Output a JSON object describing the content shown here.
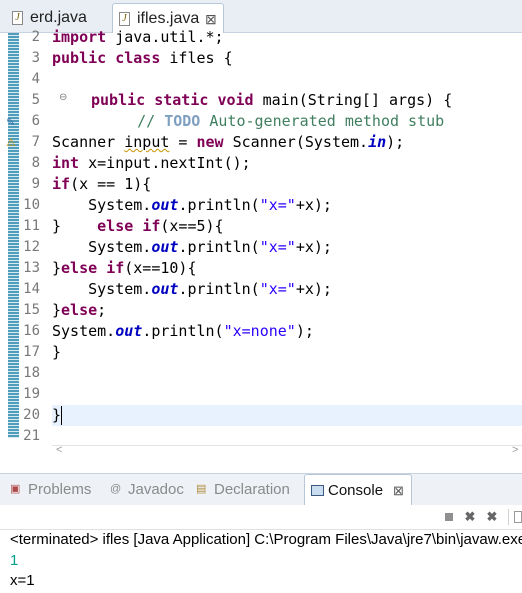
{
  "editor_tabs": [
    {
      "label": "erd.java",
      "icon": "java-file-icon"
    },
    {
      "label": "ifles.java",
      "icon": "java-file-icon",
      "close": "⊠"
    }
  ],
  "editor": {
    "line_numbers": [
      "2",
      "3",
      "4",
      "5",
      "6",
      "7",
      "8",
      "9",
      "10",
      "11",
      "12",
      "13",
      "14",
      "15",
      "16",
      "17",
      "18",
      "19",
      "20",
      "21"
    ],
    "fold_marker": "⊖",
    "markers": {
      "task": "✎",
      "warning": "⚠"
    },
    "code": {
      "l2": {
        "kw": "import",
        "rest": " java.util.*;"
      },
      "l3": {
        "kw1": "public",
        "kw2": "class",
        "rest": " ifles {"
      },
      "l5": {
        "kw1": "public",
        "kw2": "static",
        "kw3": "void",
        "rest": " main(String[] args) {"
      },
      "l6": {
        "prefix": "    // ",
        "tag": "TODO",
        "rest": " Auto-generated method stub"
      },
      "l7": {
        "a": "Scanner ",
        "var": "input",
        "b": " = ",
        "kw": "new",
        "c": " Scanner(System.",
        "fld": "in",
        "d": ");"
      },
      "l8": {
        "kw": "int",
        "rest": " x=input.nextInt();"
      },
      "l9": {
        "kw": "if",
        "rest": "(x == 1){"
      },
      "l10": {
        "a": "    System.",
        "fld": "out",
        "b": ".println(",
        "str": "\"x=\"",
        "c": "+x);"
      },
      "l11": {
        "a": "}    ",
        "kw1": "else",
        "sp": " ",
        "kw2": "if",
        "rest": "(x==5){"
      },
      "l12": {
        "a": "    System.",
        "fld": "out",
        "b": ".println(",
        "str": "\"x=\"",
        "c": "+x);"
      },
      "l13": {
        "a": "}",
        "kw1": "else",
        "sp": " ",
        "kw2": "if",
        "rest": "(x==10){"
      },
      "l14": {
        "a": "    System.",
        "fld": "out",
        "b": ".println(",
        "str": "\"x=\"",
        "c": "+x);"
      },
      "l15": {
        "a": "}",
        "kw": "else",
        "rest": ";"
      },
      "l16": {
        "a": "System.",
        "fld": "out",
        "b": ".println(",
        "str": "\"x=none\"",
        "c": ");"
      },
      "l17": {
        "text": "}"
      },
      "l20": {
        "text": "}"
      }
    },
    "hscroll": {
      "left": "<",
      "right": ">"
    }
  },
  "panel_tabs": [
    {
      "label": "Problems",
      "icon": "problems-icon"
    },
    {
      "label": "Javadoc",
      "icon": "javadoc-icon"
    },
    {
      "label": "Declaration",
      "icon": "declaration-icon"
    },
    {
      "label": "Console",
      "icon": "console-icon",
      "close": "⊠"
    }
  ],
  "console_toolbar": {
    "remove": "✖",
    "remove_all": "✖"
  },
  "console": {
    "status": "<terminated> ifles [Java Application] C:\\Program Files\\Java\\jre7\\bin\\javaw.exe",
    "input_line": "1",
    "output_line": "x=1"
  },
  "colors": {
    "keyword": "#7f0055",
    "string": "#2a00ff",
    "comment": "#3f7f5f",
    "field": "#0000c0",
    "console_input": "#00a08a"
  }
}
